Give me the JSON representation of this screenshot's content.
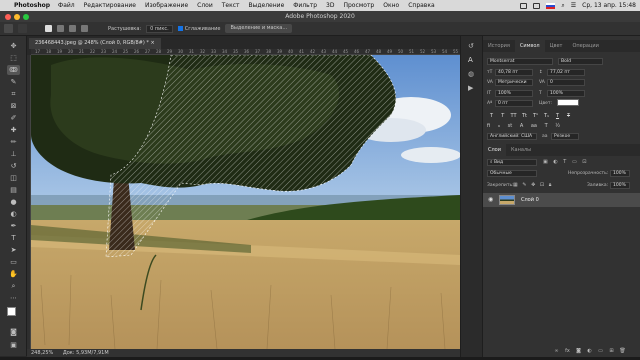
{
  "menubar": {
    "app": "Photoshop",
    "items": [
      "Файл",
      "Редактирование",
      "Изображение",
      "Слои",
      "Текст",
      "Выделение",
      "Фильтр",
      "3D",
      "Просмотр",
      "Окно",
      "Справка"
    ],
    "datetime": "Ср, 13 апр. 15:48"
  },
  "window": {
    "title": "Adobe Photoshop 2020"
  },
  "options": {
    "feather_label": "Растушевка:",
    "feather_value": "0 пикс.",
    "antialias_label": "Сглаживание",
    "select_mask_label": "Выделение и маска..."
  },
  "document": {
    "tab_title": "236468443.jpeg @ 248% (Слой 0, RGB/8#) *",
    "status": "248,25%",
    "doc_info": "Док: 5,93M/7,91M",
    "ruler_numbers": [
      "17",
      "18",
      "19",
      "20",
      "21",
      "22",
      "23",
      "24",
      "25",
      "26",
      "27",
      "28",
      "29",
      "30",
      "31",
      "32",
      "33",
      "34",
      "35",
      "36",
      "37",
      "38",
      "39",
      "40",
      "41",
      "42",
      "43",
      "44",
      "45",
      "46",
      "47",
      "48",
      "49",
      "50",
      "51",
      "52",
      "53",
      "54",
      "55"
    ]
  },
  "panels": {
    "tabs_top": [
      "История",
      "Символ",
      "Цвет",
      "Операции"
    ],
    "font_family": "Montserrat",
    "font_style": "Bold",
    "font_size": "40,78 пт",
    "leading": "77,02 пт",
    "kerning": "Метрически",
    "tracking": "0",
    "vscale": "100%",
    "hscale": "100%",
    "baseline": "0 пт",
    "color_label": "Цвет:",
    "language": "Английский: США",
    "aa": "Резкое",
    "tabs_layers": [
      "Слои",
      "Каналы"
    ],
    "kind_label": "Вид",
    "blend_mode": "Обычные",
    "opacity_label": "Непрозрачность:",
    "opacity_value": "100%",
    "lock_label": "Закрепить:",
    "fill_label": "Заливка:",
    "fill_value": "100%",
    "layer_name": "Слой 0",
    "text_buttons": [
      "T",
      "T",
      "TT",
      "Tt",
      "T¹",
      "T₁",
      "T",
      "T"
    ]
  },
  "colors": {
    "accent": "#1473e6",
    "panel_bg": "#323232"
  }
}
